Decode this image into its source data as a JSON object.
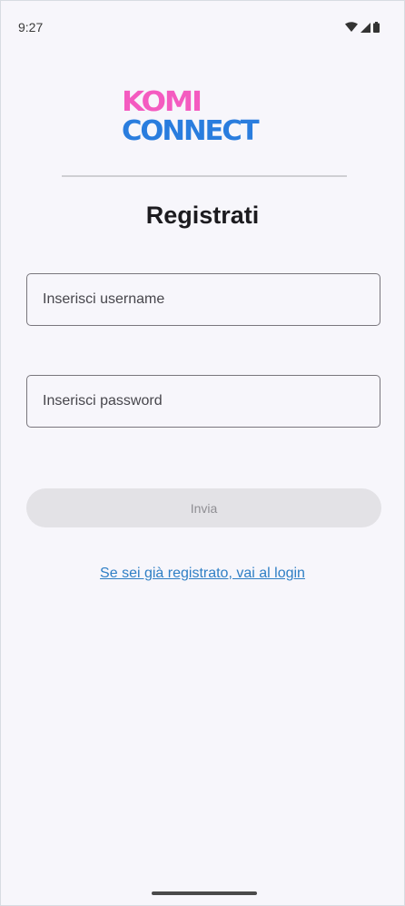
{
  "status_bar": {
    "time": "9:27",
    "icons": [
      "wifi-icon",
      "cellular-signal-icon",
      "battery-icon"
    ]
  },
  "logo": {
    "line1": "KOMI",
    "line2": "CONNECT",
    "colors": {
      "line1": "#f45bc0",
      "line2": "#2a7dde"
    }
  },
  "page": {
    "title": "Registrati"
  },
  "form": {
    "username_placeholder": "Inserisci username",
    "password_placeholder": "Inserisci password",
    "submit_label": "Invia",
    "login_link": "Se sei già registrato, vai al login"
  },
  "colors": {
    "background": "#f7f6fb",
    "link": "#2f7fc5",
    "button_disabled_bg": "#e3e2e6",
    "button_disabled_text": "#8f8e93"
  }
}
